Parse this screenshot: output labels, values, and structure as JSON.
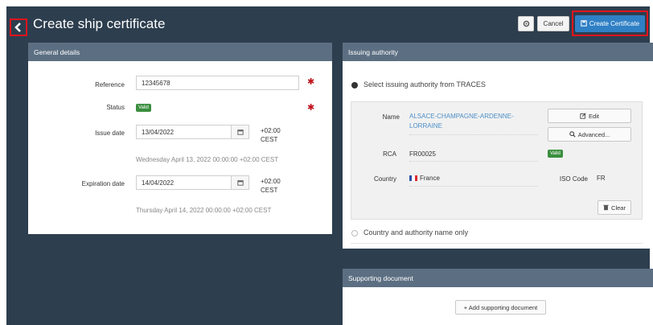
{
  "header": {
    "title": "Create ship certificate",
    "cancel_label": "Cancel",
    "create_label": "Create Certificate"
  },
  "general": {
    "title": "General details",
    "reference_label": "Reference",
    "reference_value": "12345678",
    "status_label": "Status",
    "status_value": "Valid",
    "issue_label": "Issue date",
    "issue_value": "13/04/2022",
    "issue_tz_line1": "+02:00",
    "issue_tz_line2": "CEST",
    "issue_hint": "Wednesday April 13, 2022 00:00:00 +02:00 CEST",
    "expiration_label": "Expiration date",
    "expiration_value": "14/04/2022",
    "expiration_tz_line1": "+02:00",
    "expiration_tz_line2": "CEST",
    "expiration_hint": "Thursday April 14, 2022 00:00:00 +02:00 CEST"
  },
  "issuing": {
    "title": "Issuing authority",
    "option_traces": "Select issuing authority from TRACES",
    "option_country": "Country and authority name only",
    "name_label": "Name",
    "name_value_line1": "ALSACE-CHAMPAGNE-ARDENNE-",
    "name_value_line2": "LORRAINE",
    "rca_label": "RCA",
    "rca_value": "FR00025",
    "rca_status": "Valid",
    "country_label": "Country",
    "country_value": "France",
    "iso_label": "ISO Code",
    "iso_value": "FR",
    "edit_label": "Edit",
    "advanced_label": "Advanced...",
    "clear_label": "Clear"
  },
  "supporting": {
    "title": "Supporting document",
    "add_label": "+ Add supporting document"
  },
  "colors": {
    "background": "#2d3e4e",
    "panel_header": "#5c6f82",
    "primary": "#2f80c5",
    "valid_badge": "#3a8e3e",
    "required": "#c0121c",
    "highlight": "#e0141e"
  }
}
